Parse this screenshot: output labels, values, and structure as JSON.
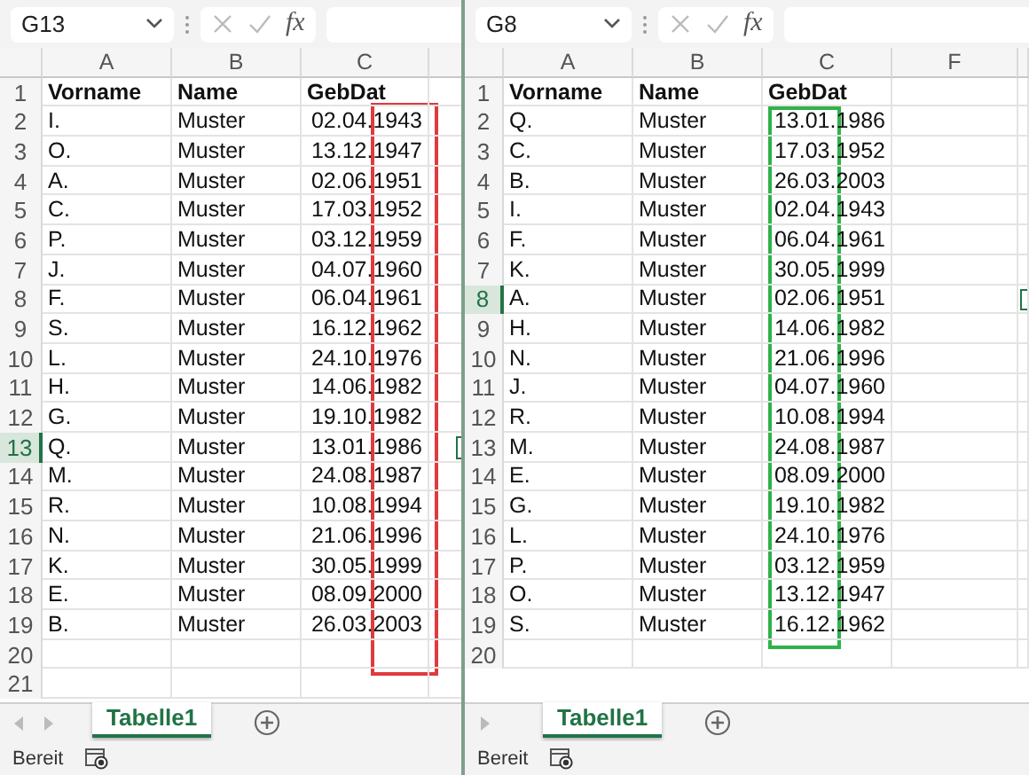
{
  "panes": [
    {
      "name_box": "G13",
      "fx": "fx",
      "columns": [
        "A",
        "B",
        "C",
        ""
      ],
      "highlight": {
        "color": "#e03a3e"
      },
      "rows": [
        {
          "number": "1",
          "cells": [
            "Vorname",
            "Name",
            "GebDat"
          ],
          "header": true,
          "selected": false
        },
        {
          "number": "2",
          "cells": [
            "I.",
            "Muster",
            "02.04.1943"
          ],
          "selected": false
        },
        {
          "number": "3",
          "cells": [
            "O.",
            "Muster",
            "13.12.1947"
          ],
          "selected": false
        },
        {
          "number": "4",
          "cells": [
            "A.",
            "Muster",
            "02.06.1951"
          ],
          "selected": false
        },
        {
          "number": "5",
          "cells": [
            "C.",
            "Muster",
            "17.03.1952"
          ],
          "selected": false
        },
        {
          "number": "6",
          "cells": [
            "P.",
            "Muster",
            "03.12.1959"
          ],
          "selected": false
        },
        {
          "number": "7",
          "cells": [
            "J.",
            "Muster",
            "04.07.1960"
          ],
          "selected": false
        },
        {
          "number": "8",
          "cells": [
            "F.",
            "Muster",
            "06.04.1961"
          ],
          "selected": false
        },
        {
          "number": "9",
          "cells": [
            "S.",
            "Muster",
            "16.12.1962"
          ],
          "selected": false
        },
        {
          "number": "10",
          "cells": [
            "L.",
            "Muster",
            "24.10.1976"
          ],
          "selected": false
        },
        {
          "number": "11",
          "cells": [
            "H.",
            "Muster",
            "14.06.1982"
          ],
          "selected": false
        },
        {
          "number": "12",
          "cells": [
            "G.",
            "Muster",
            "19.10.1982"
          ],
          "selected": false
        },
        {
          "number": "13",
          "cells": [
            "Q.",
            "Muster",
            "13.01.1986"
          ],
          "selected": true
        },
        {
          "number": "14",
          "cells": [
            "M.",
            "Muster",
            "24.08.1987"
          ],
          "selected": false
        },
        {
          "number": "15",
          "cells": [
            "R.",
            "Muster",
            "10.08.1994"
          ],
          "selected": false
        },
        {
          "number": "16",
          "cells": [
            "N.",
            "Muster",
            "21.06.1996"
          ],
          "selected": false
        },
        {
          "number": "17",
          "cells": [
            "K.",
            "Muster",
            "30.05.1999"
          ],
          "selected": false
        },
        {
          "number": "18",
          "cells": [
            "E.",
            "Muster",
            "08.09.2000"
          ],
          "selected": false
        },
        {
          "number": "19",
          "cells": [
            "B.",
            "Muster",
            "26.03.2003"
          ],
          "selected": false
        },
        {
          "number": "20",
          "cells": [],
          "selected": false
        },
        {
          "number": "21",
          "cells": [],
          "selected": false
        }
      ],
      "sheet_tab": {
        "label": "Tabelle1",
        "selected": true
      },
      "status": "Bereit"
    },
    {
      "name_box": "G8",
      "fx": "fx",
      "columns": [
        "A",
        "B",
        "C",
        "F",
        ""
      ],
      "highlight": {
        "color": "#2fb24a"
      },
      "rows": [
        {
          "number": "1",
          "cells": [
            "Vorname",
            "Name",
            "GebDat"
          ],
          "header": true,
          "selected": false
        },
        {
          "number": "2",
          "cells": [
            "Q.",
            "Muster",
            "13.01.1986"
          ],
          "selected": false
        },
        {
          "number": "3",
          "cells": [
            "C.",
            "Muster",
            "17.03.1952"
          ],
          "selected": false
        },
        {
          "number": "4",
          "cells": [
            "B.",
            "Muster",
            "26.03.2003"
          ],
          "selected": false
        },
        {
          "number": "5",
          "cells": [
            "I.",
            "Muster",
            "02.04.1943"
          ],
          "selected": false
        },
        {
          "number": "6",
          "cells": [
            "F.",
            "Muster",
            "06.04.1961"
          ],
          "selected": false
        },
        {
          "number": "7",
          "cells": [
            "K.",
            "Muster",
            "30.05.1999"
          ],
          "selected": false
        },
        {
          "number": "8",
          "cells": [
            "A.",
            "Muster",
            "02.06.1951"
          ],
          "selected": true
        },
        {
          "number": "9",
          "cells": [
            "H.",
            "Muster",
            "14.06.1982"
          ],
          "selected": false
        },
        {
          "number": "10",
          "cells": [
            "N.",
            "Muster",
            "21.06.1996"
          ],
          "selected": false
        },
        {
          "number": "11",
          "cells": [
            "J.",
            "Muster",
            "04.07.1960"
          ],
          "selected": false
        },
        {
          "number": "12",
          "cells": [
            "R.",
            "Muster",
            "10.08.1994"
          ],
          "selected": false
        },
        {
          "number": "13",
          "cells": [
            "M.",
            "Muster",
            "24.08.1987"
          ],
          "selected": false
        },
        {
          "number": "14",
          "cells": [
            "E.",
            "Muster",
            "08.09.2000"
          ],
          "selected": false
        },
        {
          "number": "15",
          "cells": [
            "G.",
            "Muster",
            "19.10.1982"
          ],
          "selected": false
        },
        {
          "number": "16",
          "cells": [
            "L.",
            "Muster",
            "24.10.1976"
          ],
          "selected": false
        },
        {
          "number": "17",
          "cells": [
            "P.",
            "Muster",
            "03.12.1959"
          ],
          "selected": false
        },
        {
          "number": "18",
          "cells": [
            "O.",
            "Muster",
            "13.12.1947"
          ],
          "selected": false
        },
        {
          "number": "19",
          "cells": [
            "S.",
            "Muster",
            "16.12.1962"
          ],
          "selected": false
        },
        {
          "number": "20",
          "cells": [],
          "selected": false
        }
      ],
      "sheet_tab": {
        "label": "Tabelle1",
        "selected": true
      },
      "status": "Bereit"
    }
  ]
}
